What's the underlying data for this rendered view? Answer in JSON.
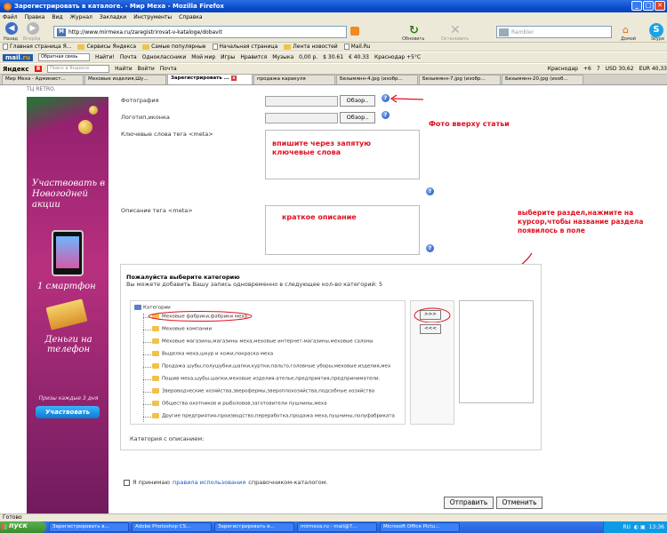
{
  "window": {
    "title": "Зарегистрировать в каталоге. - Мир Меха - Mozilla Firefox",
    "buttons": [
      "_",
      "□",
      "✕"
    ]
  },
  "menu": [
    "Файл",
    "Правка",
    "Вид",
    "Журнал",
    "Закладки",
    "Инструменты",
    "Справка"
  ],
  "nav": {
    "back_label": "Назад",
    "forward_label": "Вперёд",
    "url": "http://www.mirmexa.ru/zaregistrirovat-v-kataloge/dobavit",
    "reload_label": "Обновить",
    "stop_label": "Остановить",
    "search_placeholder": "Rambler",
    "home_label": "Домой",
    "skype_label": "Skype"
  },
  "bookmarks": [
    "Главная страница Я...",
    "Сервисы Яндекса",
    "Самые популярные",
    "Начальная страница",
    "Лента новостей",
    "Mail.Ru"
  ],
  "mailbar": {
    "logo": "mail",
    "logo_suffix": ".ru",
    "feedback": "Обратная связь",
    "find": "Найти!",
    "items": [
      "Почта",
      "Одноклассники",
      "Мой мир",
      "Игры",
      "Нравится",
      "Музыка",
      "0,00 р.",
      "$ 30.61",
      "€ 40.33",
      "Краснодар +5°C"
    ]
  },
  "yandexbar": {
    "logo": "Яндекс",
    "search_placeholder": "Поиск в Яндексе",
    "find": "Найти",
    "items": [
      "Войти",
      "Почта",
      "Краснодар",
      "+6",
      "7",
      "USD 30,62",
      "EUR 40,33"
    ]
  },
  "tabs": [
    {
      "label": "Мир Меха - Админист...",
      "active": false
    },
    {
      "label": "Меховые изделия,Шу...",
      "active": false
    },
    {
      "label": "Зарегистрировать ...",
      "active": true
    },
    {
      "label": "продажа каракуля",
      "active": false
    },
    {
      "label": "Безымянн-4.jpg (изобр...",
      "active": false
    },
    {
      "label": "Безымянн-7.jpg (изобр...",
      "active": false
    },
    {
      "label": "Безымянн-20.jpg (изоб...",
      "active": false
    }
  ],
  "page": {
    "top_cut": "ТЦ RETRO.",
    "banner": {
      "line1": "Участвовать в Новогодней акции",
      "line2": "1 смартфон",
      "line3": "Деньги на телефон",
      "line4": "Призы каждые 3 дня",
      "button": "Участвовать"
    },
    "form": {
      "photo_label": "Фотография",
      "logo_label": "Логотип,иконка",
      "keywords_label": "Ключевые слова тега <meta>",
      "description_label": "Описание тега <meta>",
      "browse": "Обзор..",
      "keywords_hint": "впишите через запятую ключевые слова",
      "description_hint": "краткое описание",
      "photo_note": "Фото вверху статьи",
      "category_note": "выберите раздел,нажмите на курсор,чтобы название раздела появилось  в поле"
    },
    "category": {
      "title": "Пожалуйста выберите категорию",
      "subtitle": "Вы можете добавить Вашу запись одновременно в следующее кол-во категорий: 5",
      "root": "Категории",
      "items": [
        "Меховые фабрики,фабрики меха",
        "Меховые компании",
        "Меховые магазины,магазины меха,меховые интернет-магазины,меховые салоны",
        "Выделка меха,шкур и кожи,покраска меха",
        "Продажа шубы,полушубки,шапки,куртки,пальто,головные уборы,меховые изделия,мех",
        "Пошив меха,шубы,шапки,меховые изделия-ателье,предприятия,предприниматели.",
        "Звероводческие хозяйства,зверофермы,звероплохозяйства,подсобные хозяйства",
        "Общества охотников и рыболовов,заготовители пушнины,меха",
        "Другие предприятия-производство,переработка,продажа меха,пушнины,полуфабриката"
      ],
      "add_btn": ">>>",
      "remove_btn": "<<<",
      "desc_label": "Категория с описанием:"
    },
    "agree_prefix": "Я принимаю",
    "agree_link": "правила использования",
    "agree_suffix": "справочником-каталогом.",
    "submit": "Отправить",
    "cancel": "Отменить"
  },
  "status": "Готово",
  "taskbar": {
    "start": "пуск",
    "items": [
      "Зарегистрировать в...",
      "Adobe Photoshop CS...",
      "Зарегистрировать в...",
      "mirmexa.ru - mail@7...",
      "Microsoft Office Pictu..."
    ],
    "lang": "RU",
    "time": "13:36"
  },
  "colors": {
    "annotation_red": "#e01020",
    "xp_blue": "#245edb",
    "banner_purple": "#b7307f"
  }
}
